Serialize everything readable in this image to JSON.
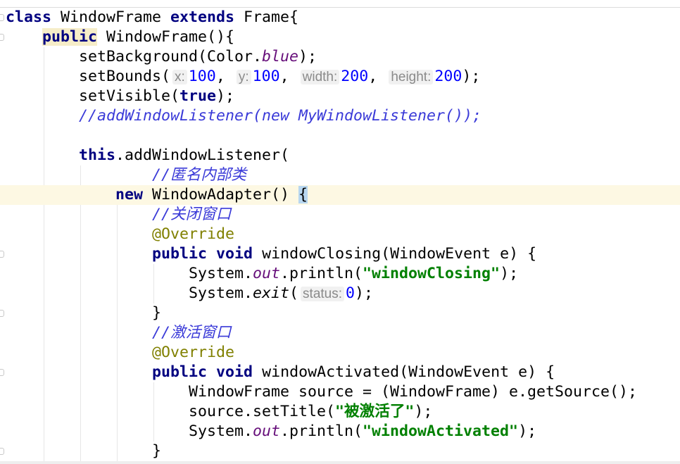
{
  "editor": {
    "lines": [
      [
        {
          "t": "class",
          "c": "kw"
        },
        {
          "t": " WindowFrame "
        },
        {
          "t": "extends",
          "c": "kw"
        },
        {
          "t": " Frame{"
        }
      ],
      [
        {
          "t": "    "
        },
        {
          "t": "public",
          "c": "kw hl"
        },
        {
          "t": " WindowFrame(){"
        }
      ],
      [
        {
          "t": "        setBackground(Color."
        },
        {
          "t": "blue",
          "c": "st"
        },
        {
          "t": ");"
        }
      ],
      [
        {
          "t": "        setBounds("
        },
        {
          "t": "x:",
          "c": "hint"
        },
        {
          "t": "100",
          "c": "num"
        },
        {
          "t": ", "
        },
        {
          "t": "y:",
          "c": "hint"
        },
        {
          "t": "100",
          "c": "num"
        },
        {
          "t": ", "
        },
        {
          "t": "width:",
          "c": "hint"
        },
        {
          "t": "200",
          "c": "num"
        },
        {
          "t": ", "
        },
        {
          "t": "height:",
          "c": "hint"
        },
        {
          "t": "200",
          "c": "num"
        },
        {
          "t": ");"
        }
      ],
      [
        {
          "t": "        setVisible("
        },
        {
          "t": "true",
          "c": "kw"
        },
        {
          "t": ");"
        }
      ],
      [
        {
          "t": "        "
        },
        {
          "t": "//addWindowListener(new MyWindowListener());",
          "c": "cm"
        }
      ],
      [],
      [
        {
          "t": "        "
        },
        {
          "t": "this",
          "c": "kw"
        },
        {
          "t": ".addWindowListener("
        }
      ],
      [
        {
          "t": "                "
        },
        {
          "t": "//匿名内部类",
          "c": "cm"
        }
      ],
      [
        {
          "t": "            "
        },
        {
          "t": "new",
          "c": "kw"
        },
        {
          "t": " WindowAdapter() "
        },
        {
          "t": "{",
          "c": "brace"
        }
      ],
      [
        {
          "t": "                "
        },
        {
          "t": "//关闭窗口",
          "c": "cm"
        }
      ],
      [
        {
          "t": "                "
        },
        {
          "t": "@Override",
          "c": "an"
        }
      ],
      [
        {
          "t": "                "
        },
        {
          "t": "public",
          "c": "kw"
        },
        {
          "t": " "
        },
        {
          "t": "void",
          "c": "kw"
        },
        {
          "t": " windowClosing(WindowEvent e) {"
        }
      ],
      [
        {
          "t": "                    System."
        },
        {
          "t": "out",
          "c": "st"
        },
        {
          "t": ".println("
        },
        {
          "t": "\"windowClosing\"",
          "c": "str"
        },
        {
          "t": ");"
        }
      ],
      [
        {
          "t": "                    System."
        },
        {
          "t": "exit",
          "c": "stm"
        },
        {
          "t": "("
        },
        {
          "t": "status:",
          "c": "hint"
        },
        {
          "t": "0",
          "c": "num"
        },
        {
          "t": ");"
        }
      ],
      [
        {
          "t": "                }"
        }
      ],
      [
        {
          "t": "                "
        },
        {
          "t": "//激活窗口",
          "c": "cm"
        }
      ],
      [
        {
          "t": "                "
        },
        {
          "t": "@Override",
          "c": "an"
        }
      ],
      [
        {
          "t": "                "
        },
        {
          "t": "public",
          "c": "kw"
        },
        {
          "t": " "
        },
        {
          "t": "void",
          "c": "kw"
        },
        {
          "t": " windowActivated(WindowEvent e) {"
        }
      ],
      [
        {
          "t": "                    WindowFrame source = (WindowFrame) e.getSource();"
        }
      ],
      [
        {
          "t": "                    source.setTitle("
        },
        {
          "t": "\"被激活了\"",
          "c": "str"
        },
        {
          "t": ");"
        }
      ],
      [
        {
          "t": "                    System."
        },
        {
          "t": "out",
          "c": "st"
        },
        {
          "t": ".println("
        },
        {
          "t": "\"windowActivated\"",
          "c": "str"
        },
        {
          "t": ");"
        }
      ],
      [
        {
          "t": "                }"
        }
      ]
    ],
    "caret_line": 9,
    "fold_marker_lines": [
      0,
      1,
      9,
      12,
      15,
      18,
      22
    ],
    "colors": {
      "keyword": "#000080",
      "comment": "#3a3ad8",
      "string": "#008000",
      "number": "#0000ff",
      "annotation": "#808000",
      "static_field": "#660e7a",
      "caret_row": "#fdf8e3"
    }
  }
}
